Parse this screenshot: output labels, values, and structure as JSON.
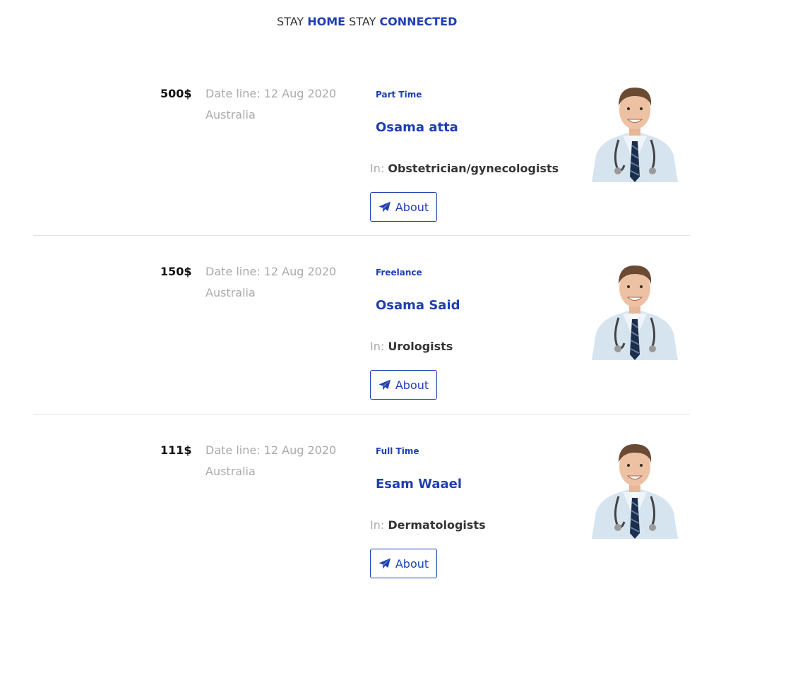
{
  "header": {
    "tagline": {
      "part1": "STAY ",
      "part2": "HOME",
      "part3": " STAY ",
      "part4": "CONNECTED"
    }
  },
  "colors": {
    "accent": "#1f3fb3",
    "muted": "#aaaaaa",
    "text": "#333333"
  },
  "listings": [
    {
      "price": "500$",
      "date_label": "Date line: 12 Aug 2020",
      "location": "Australia",
      "job_type": "Part Time",
      "name": "Osama atta",
      "in_label": "In: ",
      "specialty": "Obstetrician/gynecologists",
      "about_label": "About",
      "about_icon": "paper-plane-icon",
      "avatar_icon": "doctor-photo"
    },
    {
      "price": "150$",
      "date_label": "Date line: 12 Aug 2020",
      "location": "Australia",
      "job_type": "Freelance",
      "name": "Osama Said",
      "in_label": "In: ",
      "specialty": "Urologists",
      "about_label": "About",
      "about_icon": "paper-plane-icon",
      "avatar_icon": "doctor-photo"
    },
    {
      "price": "111$",
      "date_label": "Date line: 12 Aug 2020",
      "location": "Australia",
      "job_type": "Full Time",
      "name": "Esam Waael",
      "in_label": "In: ",
      "specialty": "Dermatologists",
      "about_label": "About",
      "about_icon": "paper-plane-icon",
      "avatar_icon": "doctor-photo"
    }
  ]
}
